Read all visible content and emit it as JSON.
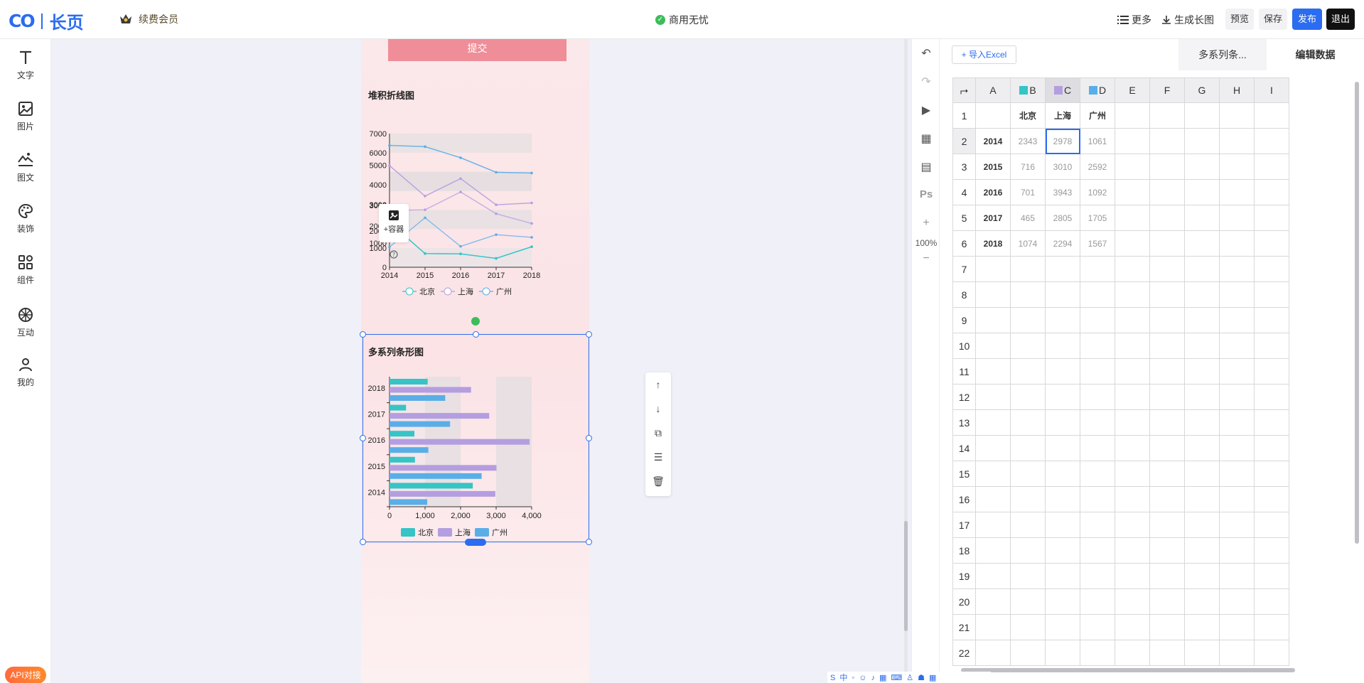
{
  "header": {
    "logo_mark": "CO",
    "logo_text": "长页",
    "vip_label": "续费会员",
    "commercial_label": "商用无忧",
    "more_label": "更多",
    "long_image_label": "生成长图",
    "preview_label": "预览",
    "save_label": "保存",
    "publish_label": "发布",
    "exit_label": "退出"
  },
  "sidebar": {
    "items": [
      {
        "label": "文字",
        "icon": "text-icon"
      },
      {
        "label": "图片",
        "icon": "image-icon"
      },
      {
        "label": "图文",
        "icon": "mountain-text-icon"
      },
      {
        "label": "装饰",
        "icon": "palette-icon"
      },
      {
        "label": "组件",
        "icon": "components-icon"
      },
      {
        "label": "互动",
        "icon": "interaction-icon"
      },
      {
        "label": "我的",
        "icon": "user-icon"
      }
    ],
    "api_label": "API对接",
    "help_icon": "help-icon"
  },
  "canvas": {
    "submit_label": "提交",
    "container_label": "+容器",
    "zoom_label": "100%"
  },
  "chart_data": [
    {
      "type": "line",
      "title": "堆积折线图",
      "x": [
        "2014",
        "2015",
        "2016",
        "2017",
        "2018"
      ],
      "yticks": [
        "0",
        "1000",
        "2000",
        "1000",
        "2000",
        "3000",
        "4000",
        "5000",
        "3000",
        "6000",
        "7000"
      ],
      "series": [
        {
          "name": "北京",
          "values": [
            2343,
            716,
            701,
            465,
            1074
          ]
        },
        {
          "name": "上海",
          "values": [
            2978,
            3010,
            3943,
            2805,
            2294
          ]
        },
        {
          "name": "广州",
          "values": [
            1061,
            2592,
            1092,
            1705,
            1567
          ]
        }
      ],
      "legend": [
        "北京",
        "上海",
        "广州"
      ],
      "colors": [
        "#36c4c6",
        "#b49ee0",
        "#5aaee8"
      ]
    },
    {
      "type": "bar",
      "title": "多系列条形图",
      "categories": [
        "2018",
        "2017",
        "2016",
        "2015",
        "2014"
      ],
      "series": [
        {
          "name": "北京",
          "values": [
            1074,
            465,
            701,
            716,
            2343
          ]
        },
        {
          "name": "上海",
          "values": [
            2294,
            2805,
            3943,
            3010,
            2978
          ]
        },
        {
          "name": "广州",
          "values": [
            1567,
            1705,
            1092,
            2592,
            1061
          ]
        }
      ],
      "xticks": [
        "0",
        "1,000",
        "2,000",
        "3,000",
        "4,000"
      ],
      "xlim": [
        0,
        4000
      ],
      "legend": [
        "北京",
        "上海",
        "广州"
      ],
      "colors": [
        "#36c4c6",
        "#b49ee0",
        "#5aaee8"
      ]
    }
  ],
  "panel": {
    "import_label": "+ 导入Excel",
    "tab_chart": "多系列条...",
    "tab_data": "编辑数据",
    "columns": [
      "A",
      "B",
      "C",
      "D",
      "E",
      "F",
      "G",
      "H",
      "I"
    ],
    "row_numbers": [
      "1",
      "2",
      "3",
      "4",
      "5",
      "6",
      "7",
      "8",
      "9",
      "10",
      "11",
      "12",
      "13",
      "14",
      "15",
      "16",
      "17",
      "18",
      "19",
      "20",
      "21",
      "22"
    ],
    "header_row": [
      "",
      "北京",
      "上海",
      "广州"
    ],
    "rows": [
      [
        "2014",
        "2343",
        "2978",
        "1061"
      ],
      [
        "2015",
        "716",
        "3010",
        "2592"
      ],
      [
        "2016",
        "701",
        "3943",
        "1092"
      ],
      [
        "2017",
        "465",
        "2805",
        "1705"
      ],
      [
        "2018",
        "1074",
        "2294",
        "1567"
      ]
    ]
  }
}
